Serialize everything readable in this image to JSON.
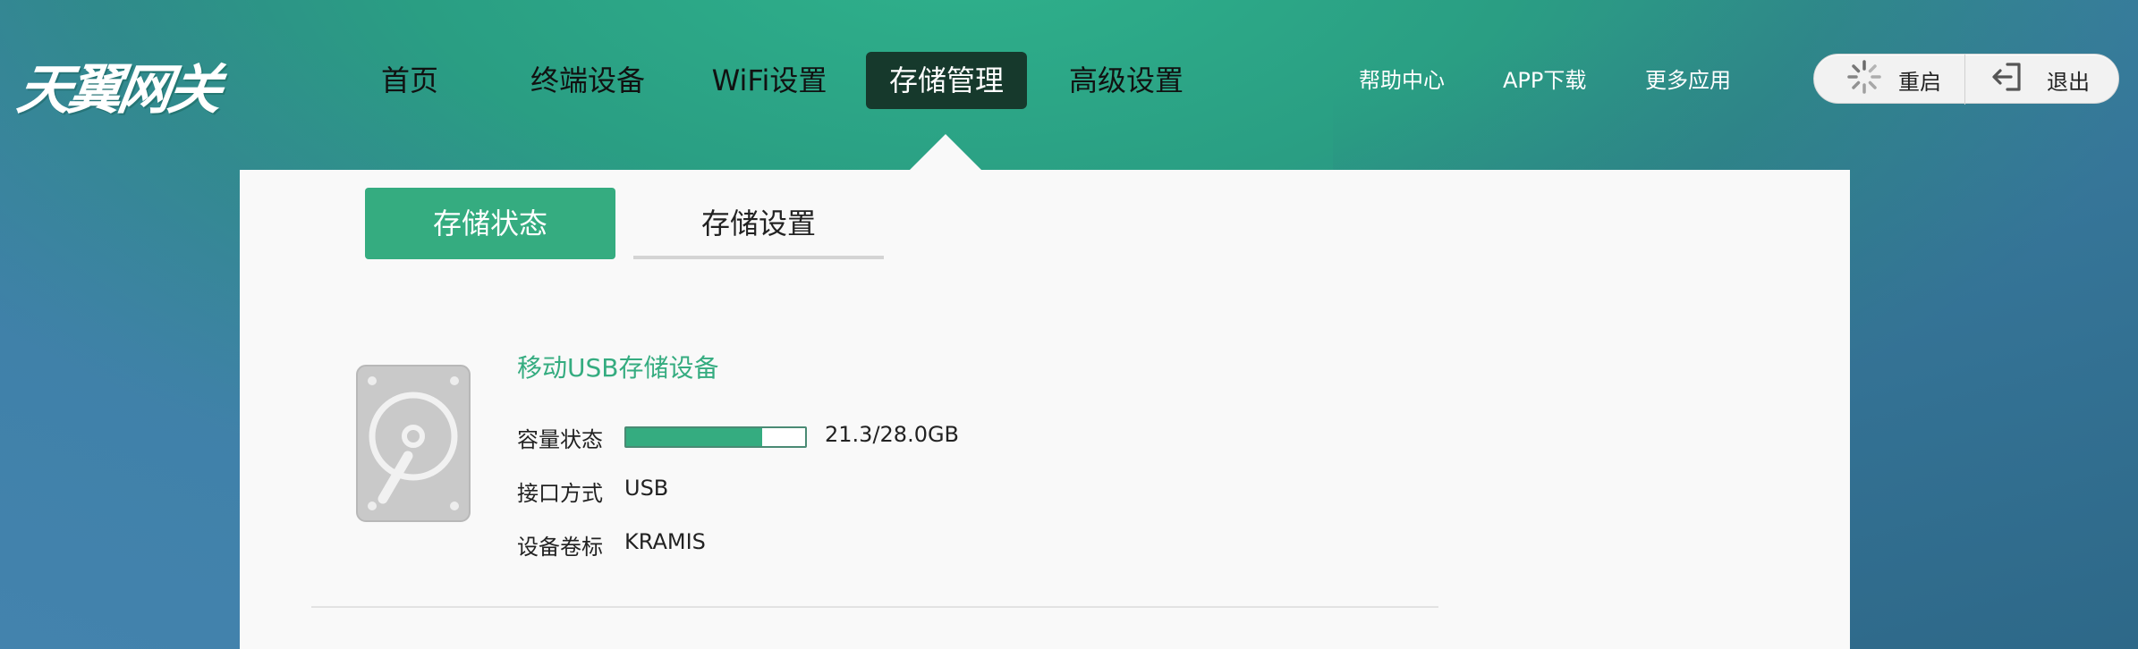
{
  "header": {
    "logo_text": "天翼网关",
    "nav": [
      {
        "label": "首页"
      },
      {
        "label": "终端设备"
      },
      {
        "label": "WiFi设置"
      },
      {
        "label": "存储管理"
      },
      {
        "label": "高级设置"
      }
    ],
    "active_nav": "存储管理",
    "links": [
      {
        "label": "帮助中心"
      },
      {
        "label": "APP下载"
      },
      {
        "label": "更多应用"
      }
    ],
    "actions": {
      "restart": {
        "label": "重启",
        "icon": "spinner-icon"
      },
      "logout": {
        "label": "退出",
        "icon": "logout-icon"
      }
    }
  },
  "subtabs": [
    {
      "label": "存储状态",
      "active": true
    },
    {
      "label": "存储设置",
      "active": false
    }
  ],
  "device": {
    "icon": "hard-drive-icon",
    "title": "移动USB存储设备",
    "rows": [
      {
        "label": "容量状态",
        "value": "21.3/28.0GB"
      },
      {
        "label": "接口方式",
        "value": "USB"
      },
      {
        "label": "设备卷标",
        "value": "KRAMIS"
      }
    ],
    "capacity_used": 21.3,
    "capacity_total": 28.0
  },
  "colors": {
    "accent": "#35ac80",
    "active_nav_bg": "#16392c",
    "panel_bg": "#f9f9f9"
  }
}
